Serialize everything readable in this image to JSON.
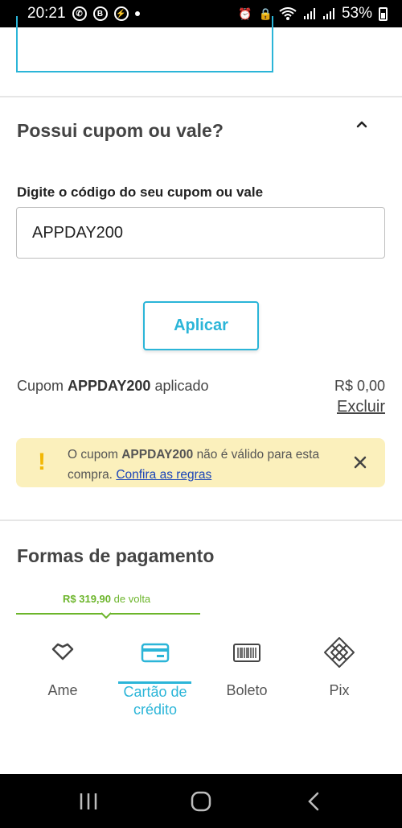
{
  "status_bar": {
    "time": "20:21",
    "battery": "53%",
    "icons": [
      "whatsapp-icon",
      "b-icon",
      "messenger-icon",
      "alarm-icon",
      "lock-icon",
      "wifi-icon",
      "signal-icon",
      "signal-icon",
      "battery-icon"
    ]
  },
  "coupon": {
    "title": "Possui cupom ou vale?",
    "field_label": "Digite o código do seu cupom ou vale",
    "input_value": "APPDAY200",
    "apply_label": "Aplicar",
    "status_prefix": "Cupom",
    "status_code": "APPDAY200",
    "status_suffix": "aplicado",
    "value": "R$ 0,00",
    "remove_label": "Excluir",
    "alert": {
      "prefix": "O cupom",
      "code": "APPDAY200",
      "suffix": "não é válido para esta compra.",
      "link": "Confira as regras",
      "icon": "warning-icon"
    }
  },
  "payment": {
    "title": "Formas de pagamento",
    "cashback_amount": "R$ 319,90",
    "cashback_text": "de volta",
    "tabs": [
      {
        "label": "Ame",
        "icon": "heart-diamond-icon"
      },
      {
        "label": "Cartão de crédito",
        "icon": "credit-card-icon",
        "active": true
      },
      {
        "label": "Boleto",
        "icon": "barcode-icon"
      },
      {
        "label": "Pix",
        "icon": "pix-icon"
      }
    ]
  },
  "colors": {
    "accent": "#2bb5d8",
    "cashback": "#6cb52b",
    "alert_bg": "#fbf0bc",
    "alert_icon": "#f2b705",
    "link": "#1a44b8"
  }
}
